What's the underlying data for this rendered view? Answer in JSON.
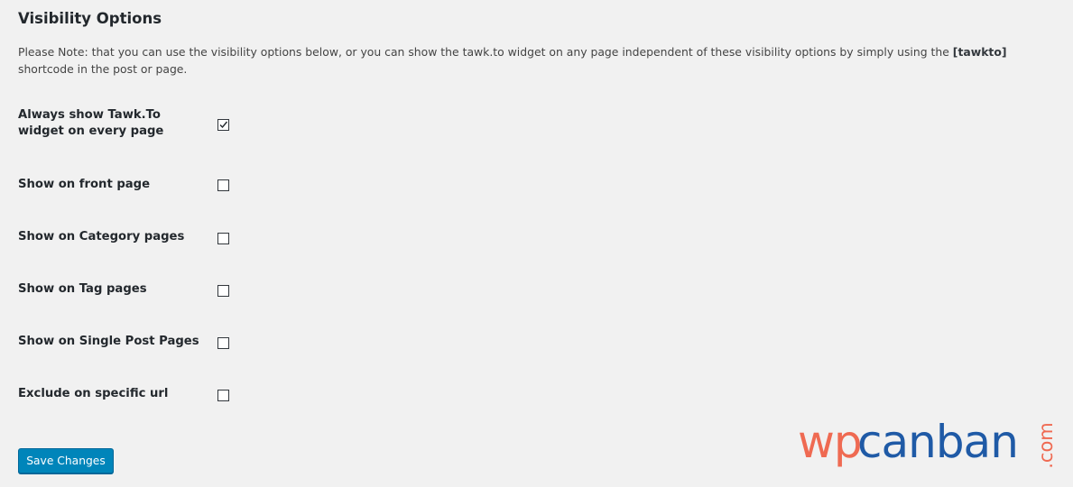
{
  "section": {
    "title": "Visibility Options",
    "note_before": "Please Note: that you can use the visibility options below, or you can show the tawk.to widget on any page independent of these visibility options by simply using the ",
    "note_code": "[tawkto]",
    "note_after": " shortcode in the post or page."
  },
  "options": [
    {
      "label": "Always show Tawk.To widget on every page",
      "checked": true
    },
    {
      "label": "Show on front page",
      "checked": false
    },
    {
      "label": "Show on Category pages",
      "checked": false
    },
    {
      "label": "Show on Tag pages",
      "checked": false
    },
    {
      "label": "Show on Single Post Pages",
      "checked": false
    },
    {
      "label": "Exclude on specific url",
      "checked": false
    }
  ],
  "actions": {
    "save_label": "Save Changes"
  },
  "watermark": {
    "part1": "wp",
    "part2": "canban",
    "part3": ".com"
  },
  "colors": {
    "background": "#f1f1f1",
    "primary_button": "#0085ba",
    "logo_orange": "#ef6a52",
    "logo_blue": "#1f5aa6"
  }
}
